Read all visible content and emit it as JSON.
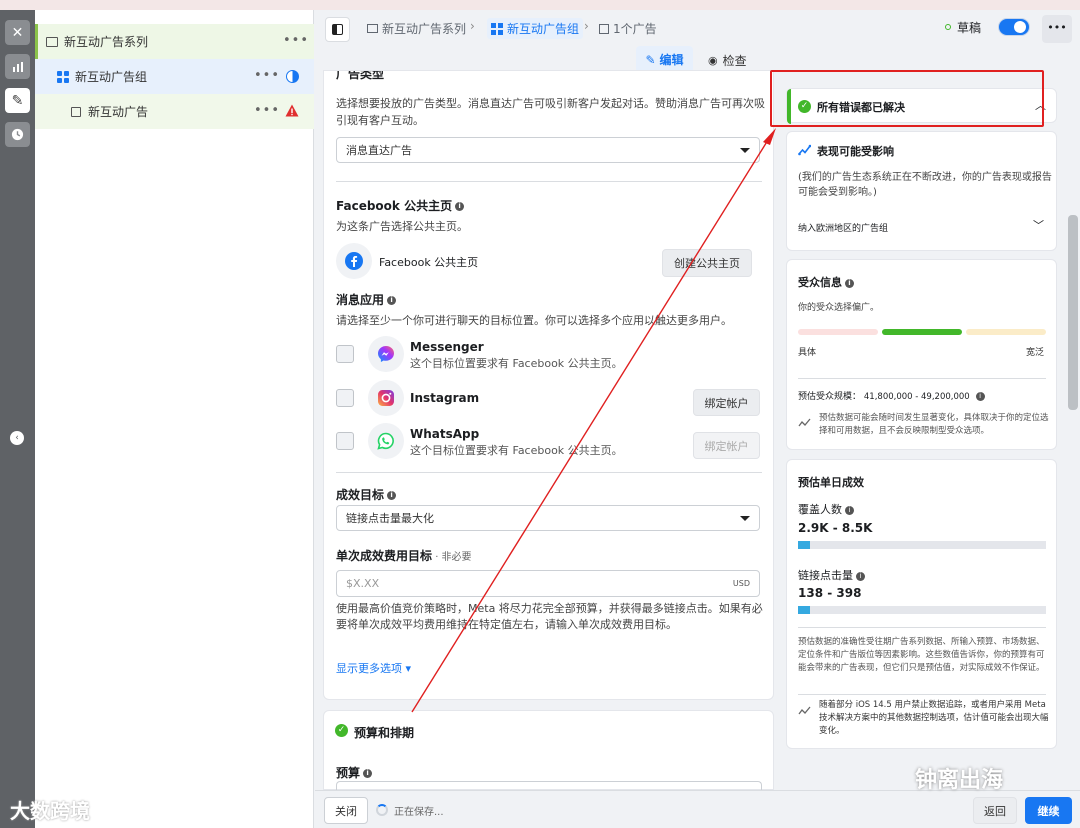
{
  "tree": {
    "campaign": "新互动广告系列",
    "adset": "新互动广告组",
    "ad": "新互动广告"
  },
  "breadcrumb": {
    "campaign": "新互动广告系列",
    "adset": "新互动广告组",
    "ad": "1个广告"
  },
  "status": {
    "draft": "草稿"
  },
  "tabs": {
    "edit": "编辑",
    "review": "检查"
  },
  "ad_type": {
    "heading": "广告类型",
    "desc": "选择想要投放的广告类型。消息直达广告可吸引新客户发起对话。赞助消息广告可再次吸引现有客户互动。",
    "selected": "消息直达广告"
  },
  "fb_page": {
    "heading": "Facebook 公共主页",
    "desc": "为这条广告选择公共主页。",
    "page_name": "Facebook 公共主页",
    "create_btn": "创建公共主页"
  },
  "messaging": {
    "heading": "消息应用",
    "desc": "请选择至少一个你可进行聊天的目标位置。你可以选择多个应用以触达更多用户。",
    "apps": [
      {
        "name": "Messenger",
        "desc": "这个目标位置要求有 Facebook 公共主页。"
      },
      {
        "name": "Instagram",
        "btn": "绑定帐户"
      },
      {
        "name": "WhatsApp",
        "desc": "这个目标位置要求有 Facebook 公共主页。",
        "btn": "绑定帐户"
      }
    ]
  },
  "goal": {
    "heading": "成效目标",
    "selected": "链接点击量最大化"
  },
  "cost": {
    "heading": "单次成效费用目标",
    "optional": " · 非必要",
    "placeholder": "$X.XX",
    "currency": "USD",
    "desc": "使用最高价值竞价策略时，Meta 将尽力花完全部预算，并获得最多链接点击。如果有必要将单次成效平均费用维持在特定值左右，请输入单次成效费用目标。",
    "more": "显示更多选项"
  },
  "budget": {
    "heading": "预算和排期",
    "label": "预算"
  },
  "right": {
    "errors": "所有错误都已解决",
    "impact_title": "表现可能受影响",
    "impact_desc": "(我们的广告生态系统正在不断改进，你的广告表现或报告可能会受到影响。)",
    "impact_item": "纳入欧洲地区的广告组",
    "audience_title": "受众信息",
    "audience_desc": "你的受众选择偏广。",
    "specific": "具体",
    "broad": "宽泛",
    "est_label": "预估受众规模：",
    "est_value": "41,800,000 - 49,200,000",
    "est_note": "预估数据可能会随时间发生显著变化，具体取决于你的定位选择和可用数据，且不会反映限制型受众选项。",
    "daily_title": "预估单日成效",
    "reach_label": "覆盖人数",
    "reach_value": "2.9K - 8.5K",
    "reach_fraction": 0.05,
    "clicks_label": "链接点击量",
    "clicks_value": "138 - 398",
    "clicks_fraction": 0.05,
    "daily_note": "预估数据的准确性受往期广告系列数据、所输入预算、市场数据、定位条件和广告版位等因素影响。这些数值告诉你，你的预算有可能会带来的广告表现，但它们只是预估值，对实际成效不作保证。",
    "ios_note": "随着部分 iOS 14.5 用户禁止数据追踪，或者用户采用 Meta 技术解决方案中的其他数据控制选项，估计值可能会出现大幅变化。"
  },
  "bottom": {
    "close": "关闭",
    "saving": "正在保存...",
    "back": "返回",
    "next": "继续"
  },
  "watermarks": {
    "right": "钟离出海",
    "left": "大数跨境"
  },
  "colors": {
    "accent": "#1877f2",
    "green": "#42b72a",
    "annotation_red": "#e02020",
    "error_red": "#e02f2f"
  }
}
